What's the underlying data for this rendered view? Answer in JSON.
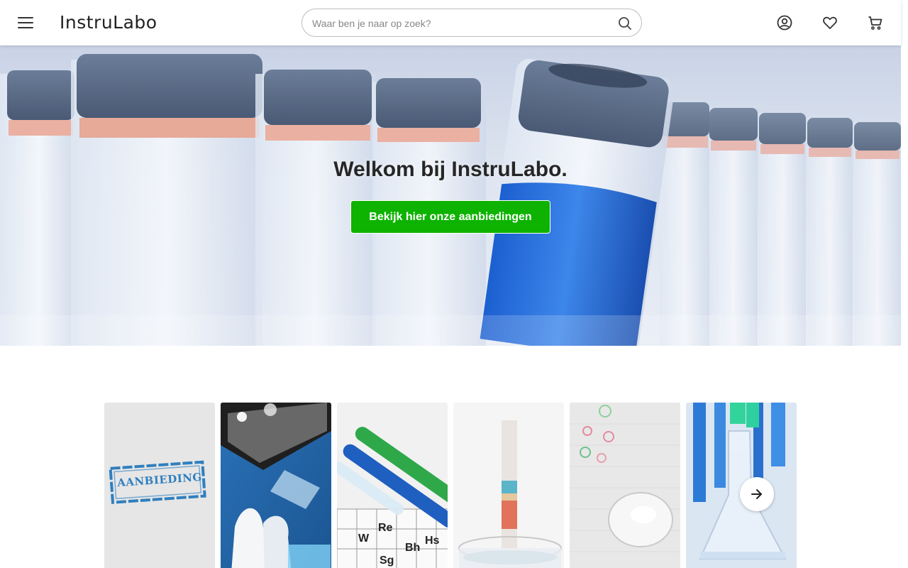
{
  "header": {
    "logo": "InstruLabo",
    "search": {
      "placeholder": "Waar ben je naar op zoek?",
      "value": ""
    },
    "icons": [
      "menu-icon",
      "search-icon",
      "account-icon",
      "heart-icon",
      "cart-icon"
    ]
  },
  "hero": {
    "title": "Welkom bij InstruLabo.",
    "cta_label": "Bekijk hier onze aanbiedingen"
  },
  "carousel": {
    "tiles": [
      {
        "name": "aanbieding",
        "stamp_text": "AANBIEDING"
      },
      {
        "name": "gloves-and-glassware"
      },
      {
        "name": "test-tubes-periodic-table",
        "elements": [
          "W",
          "Re",
          "Sg",
          "Bh",
          "Hs"
        ]
      },
      {
        "name": "chromatography-strip"
      },
      {
        "name": "petri-dishes"
      },
      {
        "name": "blue-flasks"
      }
    ]
  },
  "colors": {
    "cta": "#0db300",
    "accent_blue": "#1f66d1"
  }
}
